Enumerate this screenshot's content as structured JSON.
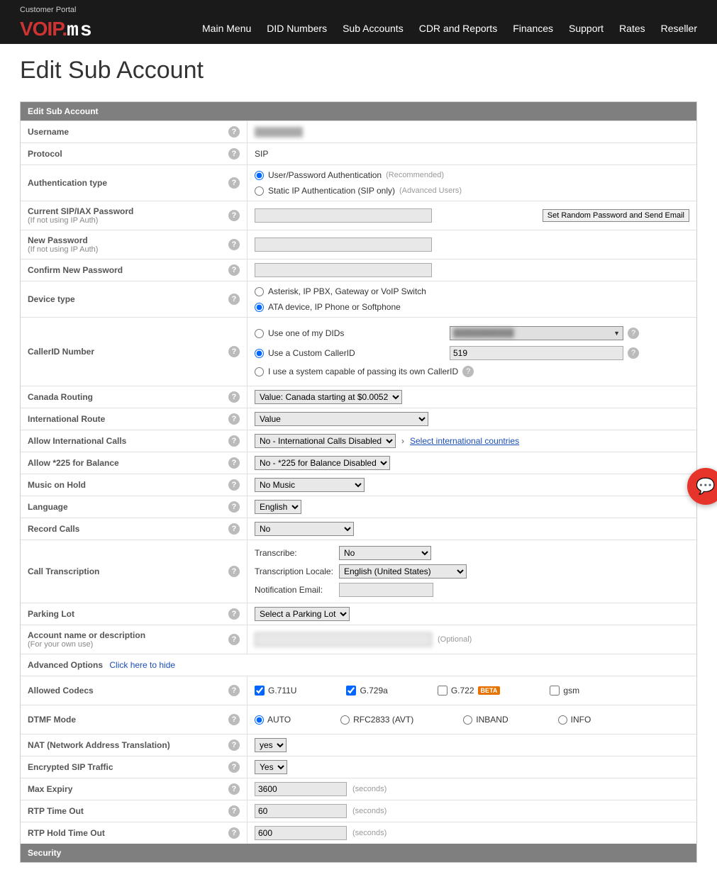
{
  "header": {
    "portal_label": "Customer Portal",
    "nav": [
      "Main Menu",
      "DID Numbers",
      "Sub Accounts",
      "CDR and Reports",
      "Finances",
      "Support",
      "Rates",
      "Reseller"
    ]
  },
  "page_title": "Edit Sub Account",
  "panel_title": "Edit Sub Account",
  "labels": {
    "username": "Username",
    "protocol": "Protocol",
    "auth_type": "Authentication type",
    "current_pw": "Current SIP/IAX Password",
    "current_pw_sub": "(If not using IP Auth)",
    "new_pw": "New Password",
    "new_pw_sub": "(If not using IP Auth)",
    "confirm_pw": "Confirm New Password",
    "device_type": "Device type",
    "callerid": "CallerID Number",
    "canada_routing": "Canada Routing",
    "intl_route": "International Route",
    "allow_intl": "Allow International Calls",
    "allow_225": "Allow *225 for Balance",
    "moh": "Music on Hold",
    "language": "Language",
    "record_calls": "Record Calls",
    "transcription": "Call Transcription",
    "parking": "Parking Lot",
    "account_name": "Account name or description",
    "account_name_sub": "(For your own use)",
    "advanced": "Advanced Options",
    "advanced_toggle": "Click here to hide",
    "allowed_codecs": "Allowed Codecs",
    "dtmf": "DTMF Mode",
    "nat": "NAT (Network Address Translation)",
    "encrypted_sip": "Encrypted SIP Traffic",
    "max_expiry": "Max Expiry",
    "rtp_timeout": "RTP Time Out",
    "rtp_hold_timeout": "RTP Hold Time Out"
  },
  "values": {
    "username": "████████",
    "protocol": "SIP",
    "auth_type": {
      "opt1": "User/Password Authentication",
      "opt1_hint": "(Recommended)",
      "opt2": "Static IP Authentication (SIP only)",
      "opt2_hint": "(Advanced Users)"
    },
    "set_random_btn": "Set Random Password and Send Email",
    "device_type": {
      "opt1": "Asterisk, IP PBX, Gateway or VoIP Switch",
      "opt2": "ATA device, IP Phone or Softphone"
    },
    "callerid": {
      "opt1": "Use one of my DIDs",
      "did_value": "███████████",
      "opt2": "Use a Custom CallerID",
      "custom_value": "519",
      "opt3": "I use a system capable of passing its own CallerID"
    },
    "canada_routing": "Value: Canada starting at $0.0052",
    "intl_route": "Value",
    "allow_intl": "No - International Calls Disabled",
    "select_intl_link": "Select international countries",
    "allow_225": "No - *225 for Balance Disabled",
    "moh": "No Music",
    "language": "English",
    "record_calls": "No",
    "transcription": {
      "transcribe_label": "Transcribe:",
      "transcribe_value": "No",
      "locale_label": "Transcription Locale:",
      "locale_value": "English (United States)",
      "email_label": "Notification Email:"
    },
    "parking": "Select a Parking Lot",
    "account_name_hint": "(Optional)",
    "codecs": {
      "g711u": "G.711U",
      "g729a": "G.729a",
      "g722": "G.722",
      "beta": "BETA",
      "gsm": "gsm"
    },
    "dtmf": {
      "auto": "AUTO",
      "rfc": "RFC2833 (AVT)",
      "inband": "INBAND",
      "info": "INFO"
    },
    "nat": "yes",
    "encrypted_sip": "Yes",
    "max_expiry": "3600",
    "rtp_timeout": "60",
    "rtp_hold_timeout": "600",
    "seconds_hint": "(seconds)"
  },
  "security_header": "Security"
}
